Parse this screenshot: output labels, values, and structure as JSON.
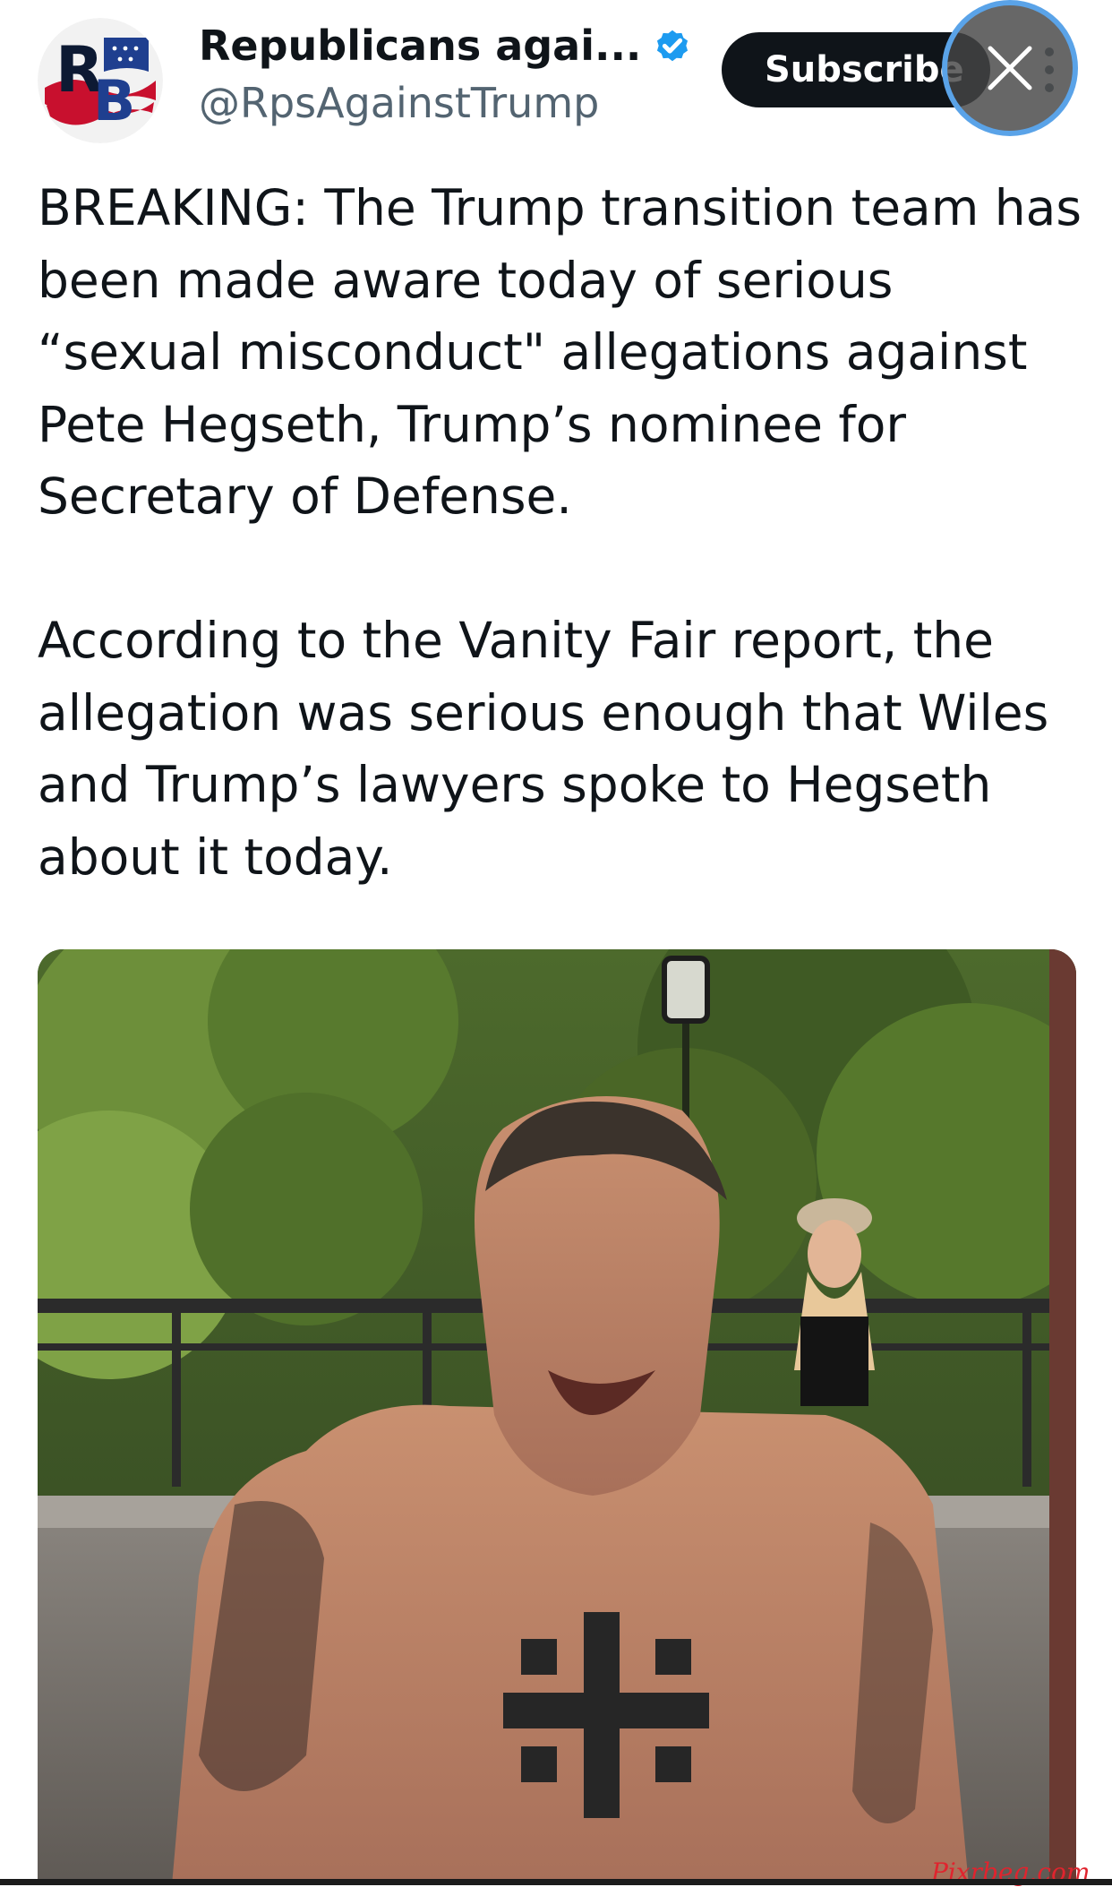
{
  "account": {
    "display_name": "Republicans agai...",
    "handle": "@RpsAgainstTrump",
    "avatar_icon": "rb-logo-avatar",
    "avatar_letters": "RB",
    "verified_icon": "verified-badge-icon",
    "verified_color": "#1d9bf0"
  },
  "actions": {
    "subscribe_label": "Subscribe",
    "more_icon": "more-vertical-icon",
    "close_icon": "close-icon"
  },
  "tweet": {
    "paragraphs": [
      "BREAKING: The Trump transition team has been made aware today of serious “sexual misconduct\" allegations against Pete Hegseth, Trump’s nominee for Secretary of Defense.",
      "According to the Vanity Fair report, the allegation was serious enough that Wiles and Trump’s lawyers spoke to Hegseth about it today."
    ]
  },
  "media": {
    "watermark": "Pixrbeg.com"
  },
  "colors": {
    "text": "#0f1419",
    "secondary_text": "#536471",
    "subscribe_bg": "#0f1419",
    "close_ring": "#5aa3e8",
    "watermark": "#e0242e"
  }
}
